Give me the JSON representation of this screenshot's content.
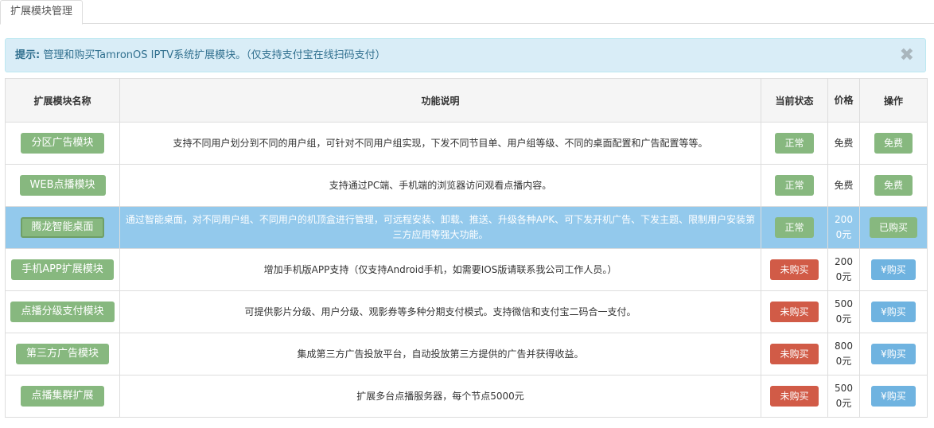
{
  "tab": {
    "label": "扩展模块管理"
  },
  "alert": {
    "prefix": "提示:",
    "text": " 管理和购买TamronOS IPTV系统扩展模块。（仅支持支付宝在线扫码支付）",
    "close": "✖"
  },
  "table": {
    "headers": {
      "name": "扩展模块名称",
      "desc": "功能说明",
      "status": "当前状态",
      "price": "价格",
      "action": "操作"
    },
    "rows": [
      {
        "name": "分区广告模块",
        "desc": "支持不同用户划分到不同的用户组，可针对不同用户组实现，下发不同节目单、用户组等级、不同的桌面配置和广告配置等等。",
        "status": "正常",
        "price": "免费",
        "action": "免费"
      },
      {
        "name": "WEB点播模块",
        "desc": "支持通过PC端、手机端的浏览器访问观看点播内容。",
        "status": "正常",
        "price": "免费",
        "action": "免费"
      },
      {
        "name": "腾龙智能桌面",
        "desc": "通过智能桌面，对不同用户组、不同用户的机顶盒进行管理，可远程安装、卸载、推送、升级各种APK、可下发开机广告、下发主题、限制用户安装第三方应用等强大功能。",
        "status": "正常",
        "price": "2000元",
        "action": "已购买"
      },
      {
        "name": "手机APP扩展模块",
        "desc": "增加手机版APP支持（仅支持Android手机，如需要IOS版请联系我公司工作人员。）",
        "status": "未购买",
        "price": "2000元",
        "action": "¥购买"
      },
      {
        "name": "点播分级支付模块",
        "desc": "可提供影片分级、用户分级、观影券等多种分期支付模式。支持微信和支付宝二码合一支付。",
        "status": "未购买",
        "price": "5000元",
        "action": "¥购买"
      },
      {
        "name": "第三方广告模块",
        "desc": "集成第三方广告投放平台，自动投放第三方提供的广告并获得收益。",
        "status": "未购买",
        "price": "8000元",
        "action": "¥购买"
      },
      {
        "name": "点播集群扩展",
        "desc": "扩展多台点播服务器，每个节点5000元",
        "status": "未购买",
        "price": "5000元",
        "action": "¥购买"
      }
    ]
  },
  "colors": {
    "green": "#87b87f",
    "red": "#d15b47",
    "blue": "#6fb3e0",
    "highlight": "#93c9ec",
    "alert_bg": "#d9edf7",
    "alert_text": "#31708f"
  }
}
